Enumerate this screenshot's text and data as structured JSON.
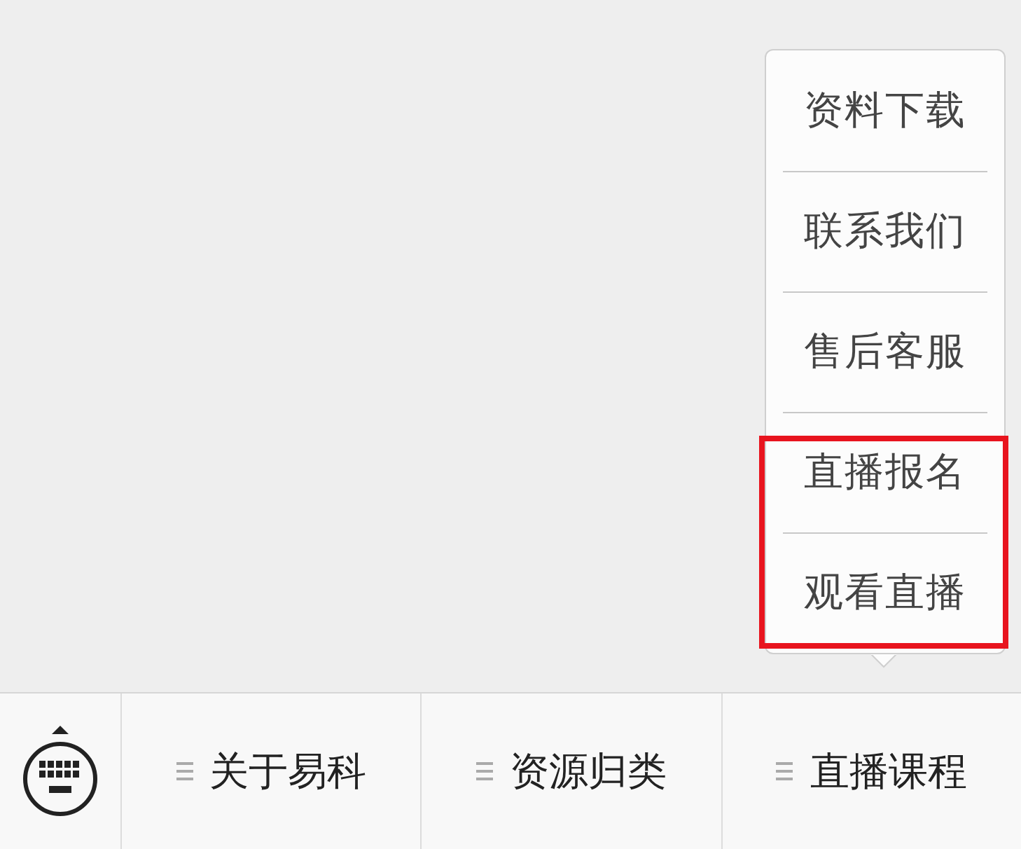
{
  "popup_menu": {
    "items": [
      {
        "label": "资料下载",
        "highlighted": false
      },
      {
        "label": "联系我们",
        "highlighted": false
      },
      {
        "label": "售后客服",
        "highlighted": false
      },
      {
        "label": "直播报名",
        "highlighted": true
      },
      {
        "label": "观看直播",
        "highlighted": true
      }
    ]
  },
  "bottom_menu": {
    "tabs": [
      {
        "label": "关于易科"
      },
      {
        "label": "资源归类"
      },
      {
        "label": "直播课程"
      }
    ]
  }
}
